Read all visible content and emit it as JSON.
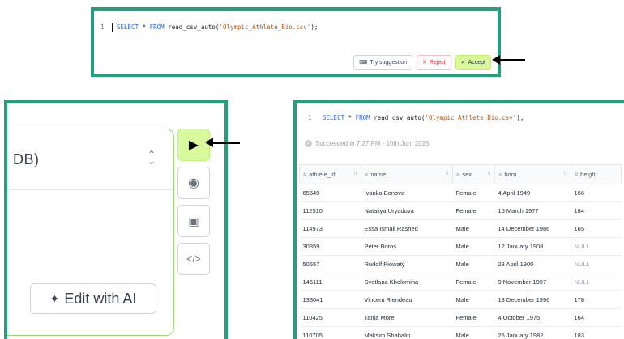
{
  "sql_line_number": "1",
  "sql": {
    "kw1": "SELECT",
    "star": " * ",
    "kw2": "FROM",
    "fn": " read_csv_auto(",
    "str": "'Olympic_Athlete_Bio.csv'",
    "end": ");"
  },
  "suggestion": {
    "try_label": "Try suggestion",
    "reject_label": "Reject",
    "accept_label": "Accept"
  },
  "editor": {
    "db_label": "DB)",
    "edit_ai_label": "Edit with AI"
  },
  "result": {
    "status": "Succeeded in 7:27 PM - 10th Jun, 2025",
    "columns": [
      "athlete_id",
      "name",
      "sex",
      "born",
      "height"
    ],
    "rows": [
      [
        "65649",
        "Ivanka Bonova",
        "Female",
        "4 April 1949",
        "166"
      ],
      [
        "112510",
        "Nataliya Uryadova",
        "Female",
        "15 March 1977",
        "184"
      ],
      [
        "114973",
        "Essa Ismail Rashed",
        "Male",
        "14 December 1986",
        "165"
      ],
      [
        "30359",
        "Péter Boros",
        "Male",
        "12 January 1908",
        "NULL"
      ],
      [
        "50557",
        "Rudolf Piowatý",
        "Male",
        "28 April 1900",
        "NULL"
      ],
      [
        "146111",
        "Svetlana Kholomina",
        "Female",
        "9 November 1997",
        "NULL"
      ],
      [
        "133041",
        "Vincent Riendeau",
        "Male",
        "13 December 1996",
        "178"
      ],
      [
        "110425",
        "Tanja Morel",
        "Female",
        "4 October 1975",
        "164"
      ],
      [
        "110705",
        "Maksim Shabalin",
        "Male",
        "25 January 1982",
        "183"
      ]
    ]
  },
  "colors": {
    "frame": "#22a07e",
    "accept": "#d9f99d",
    "keyword": "#2563eb",
    "string": "#b45309"
  }
}
